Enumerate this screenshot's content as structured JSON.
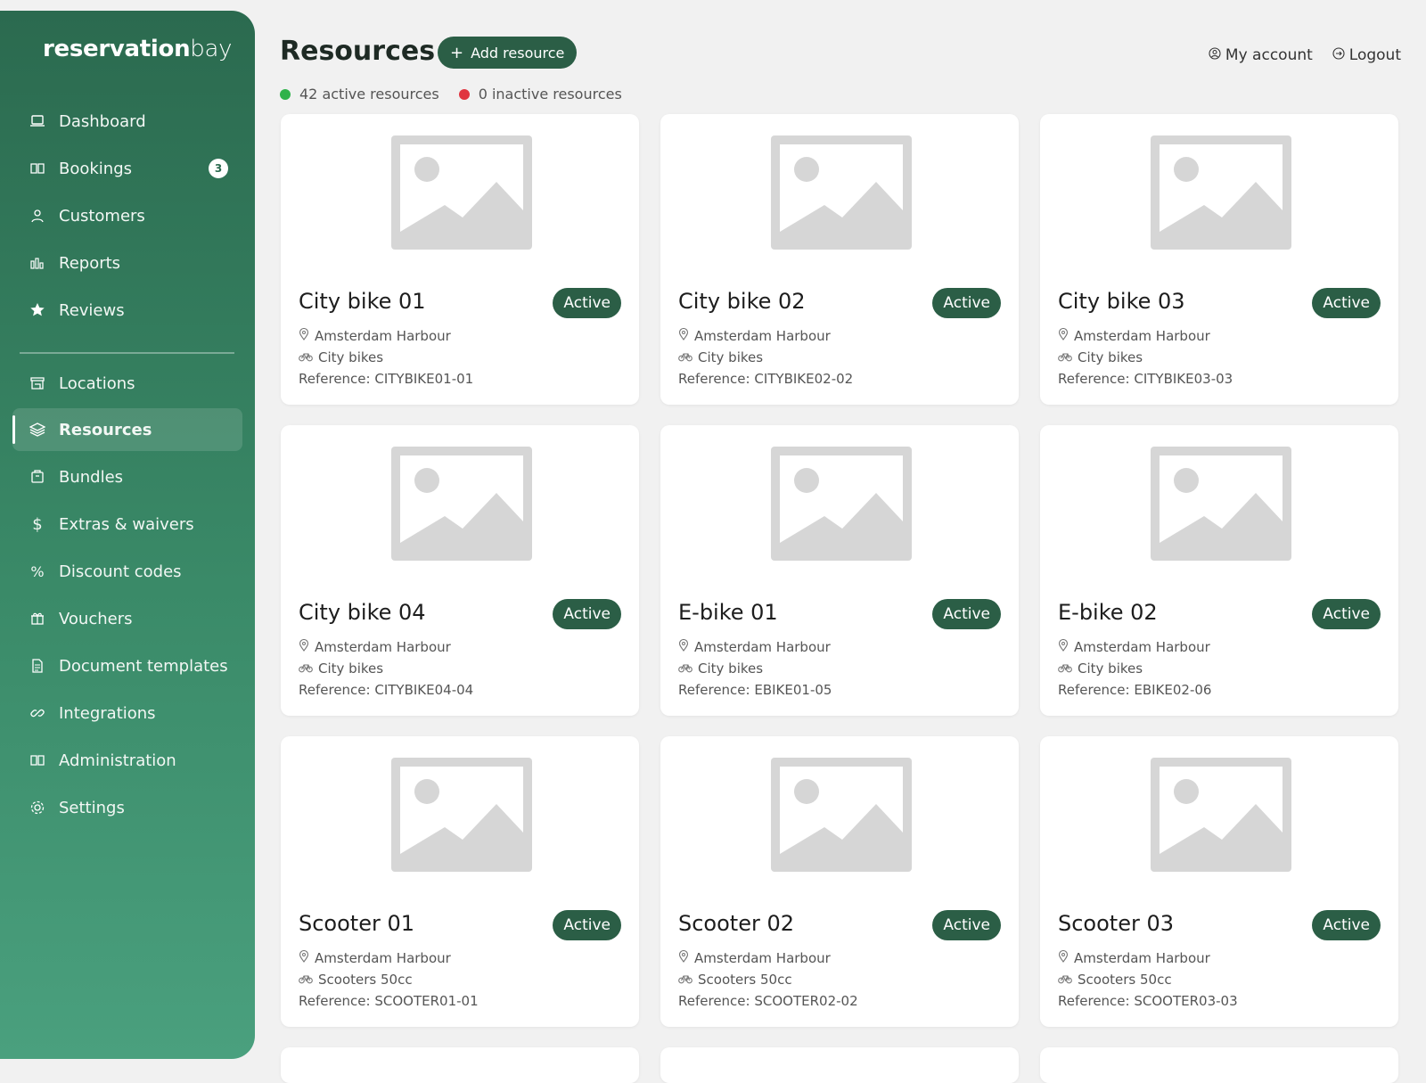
{
  "app": {
    "logo_bold": "reservation",
    "logo_light": "bay"
  },
  "sidebar": {
    "items": [
      {
        "label": "Dashboard",
        "icon": "laptop-icon"
      },
      {
        "label": "Bookings",
        "icon": "book-icon",
        "badge": "3"
      },
      {
        "label": "Customers",
        "icon": "user-icon"
      },
      {
        "label": "Reports",
        "icon": "bar-chart-icon"
      },
      {
        "label": "Reviews",
        "icon": "star-icon"
      },
      {
        "label": "Locations",
        "icon": "store-icon"
      },
      {
        "label": "Resources",
        "icon": "layers-icon",
        "active": true
      },
      {
        "label": "Bundles",
        "icon": "package-icon"
      },
      {
        "label": "Extras & waivers",
        "icon": "dollar-icon"
      },
      {
        "label": "Discount codes",
        "icon": "percent-icon"
      },
      {
        "label": "Vouchers",
        "icon": "gift-icon"
      },
      {
        "label": "Document templates",
        "icon": "document-icon"
      },
      {
        "label": "Integrations",
        "icon": "link-icon"
      },
      {
        "label": "Administration",
        "icon": "book-open-icon"
      },
      {
        "label": "Settings",
        "icon": "gear-icon"
      }
    ]
  },
  "header": {
    "title": "Resources",
    "add_button": "Add resource",
    "my_account": "My account",
    "logout": "Logout"
  },
  "stats": {
    "active": "42 active resources",
    "inactive": "0 inactive resources"
  },
  "colors": {
    "brand": "#2b5e46",
    "active_dot": "#2fb24a",
    "inactive_dot": "#e0343f"
  },
  "resources": [
    {
      "name": "City bike 01",
      "status": "Active",
      "location": "Amsterdam Harbour",
      "category": "City bikes",
      "reference": "Reference: CITYBIKE01-01"
    },
    {
      "name": "City bike 02",
      "status": "Active",
      "location": "Amsterdam Harbour",
      "category": "City bikes",
      "reference": "Reference: CITYBIKE02-02"
    },
    {
      "name": "City bike 03",
      "status": "Active",
      "location": "Amsterdam Harbour",
      "category": "City bikes",
      "reference": "Reference: CITYBIKE03-03"
    },
    {
      "name": "City bike 04",
      "status": "Active",
      "location": "Amsterdam Harbour",
      "category": "City bikes",
      "reference": "Reference: CITYBIKE04-04"
    },
    {
      "name": "E-bike 01",
      "status": "Active",
      "location": "Amsterdam Harbour",
      "category": "City bikes",
      "reference": "Reference: EBIKE01-05"
    },
    {
      "name": "E-bike 02",
      "status": "Active",
      "location": "Amsterdam Harbour",
      "category": "City bikes",
      "reference": "Reference: EBIKE02-06"
    },
    {
      "name": "Scooter 01",
      "status": "Active",
      "location": "Amsterdam Harbour",
      "category": "Scooters 50cc",
      "reference": "Reference: SCOOTER01-01"
    },
    {
      "name": "Scooter 02",
      "status": "Active",
      "location": "Amsterdam Harbour",
      "category": "Scooters 50cc",
      "reference": "Reference: SCOOTER02-02"
    },
    {
      "name": "Scooter 03",
      "status": "Active",
      "location": "Amsterdam Harbour",
      "category": "Scooters 50cc",
      "reference": "Reference: SCOOTER03-03"
    }
  ]
}
